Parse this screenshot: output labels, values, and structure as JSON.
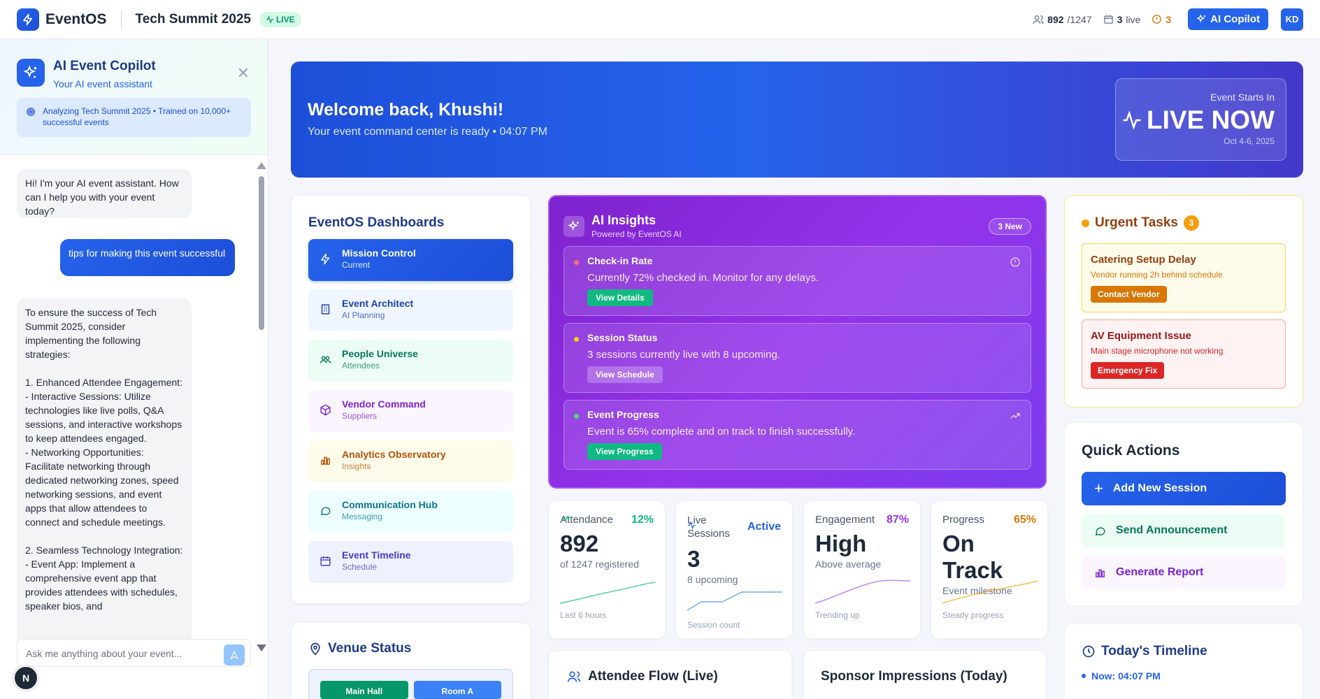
{
  "topbar": {
    "brand": "EventOS",
    "event_title": "Tech Summit 2025",
    "live_label": "LIVE",
    "attendees": "892",
    "attendees_total": "/1247",
    "live_sessions": "3",
    "live_sessions_label": "live",
    "alerts": "3",
    "copilot_label": "AI Copilot",
    "user_initials": "KD"
  },
  "sidebar": {
    "title": "AI Event Copilot",
    "subtitle": "Your AI event assistant",
    "banner": "Analyzing Tech Summit 2025 • Trained on 10,000+ successful events",
    "messages": [
      {
        "role": "bot",
        "text": "Hi! I'm your AI event assistant. How can I help you with your event today?"
      },
      {
        "role": "user",
        "text": "tips for making this event successful"
      },
      {
        "role": "bot",
        "text": "To ensure the success of Tech Summit 2025, consider implementing the following strategies:\n\n1. Enhanced Attendee Engagement:\n- Interactive Sessions: Utilize technologies like live polls, Q&A sessions, and interactive workshops to keep attendees engaged.\n- Networking Opportunities: Facilitate networking through dedicated networking zones, speed networking sessions, and event apps that allow attendees to connect and schedule meetings.\n\n2. Seamless Technology Integration:\n- Event App: Implement a comprehensive event app that provides attendees with schedules, speaker bios, and"
      }
    ],
    "input_placeholder": "Ask me anything about your event...",
    "badge": "N"
  },
  "hero": {
    "greeting": "Welcome back, Khushi!",
    "subtitle": "Your event command center is ready • 04:07 PM",
    "starts_label": "Event Starts In",
    "status": "LIVE NOW",
    "dates": "Oct 4-6, 2025"
  },
  "dashboards": {
    "title": "EventOS Dashboards",
    "items": [
      {
        "label": "Mission Control",
        "sub": "Current"
      },
      {
        "label": "Event Architect",
        "sub": "AI Planning"
      },
      {
        "label": "People Universe",
        "sub": "Attendees"
      },
      {
        "label": "Vendor Command",
        "sub": "Suppliers"
      },
      {
        "label": "Analytics Observatory",
        "sub": "Insights"
      },
      {
        "label": "Communication Hub",
        "sub": "Messaging"
      },
      {
        "label": "Event Timeline",
        "sub": "Schedule"
      }
    ],
    "colors": [
      "#2563eb",
      "#1e40af",
      "#047857",
      "#7e22ce",
      "#b45309",
      "#0e7490",
      "#4338ca"
    ],
    "bg": [
      "#2563eb",
      "#eff6ff",
      "#ecfdf5",
      "#faf5ff",
      "#fffbeb",
      "#ecfeff",
      "#eef2ff"
    ]
  },
  "venue": {
    "title": "Venue Status",
    "rooms": [
      "Main Hall",
      "Room A"
    ]
  },
  "insights": {
    "title": "AI Insights",
    "powered": "Powered by EventOS AI",
    "badge": "3 New",
    "items": [
      {
        "title": "Check-in Rate",
        "desc": "Currently 72% checked in. Monitor for any delays.",
        "button": "View Details"
      },
      {
        "title": "Session Status",
        "desc": "3 sessions currently live with 8 upcoming.",
        "button": "View Schedule"
      },
      {
        "title": "Event Progress",
        "desc": "Event is 65% complete and on track to finish successfully.",
        "button": "View Progress"
      }
    ]
  },
  "kpis": [
    {
      "title": "Attendance",
      "change": "12%",
      "value": "892",
      "sub": "of 1247 registered",
      "foot": "Last 6 hours",
      "color": "#10b981"
    },
    {
      "title": "Live Sessions",
      "change": "Active",
      "value": "3",
      "sub": "8 upcoming",
      "foot": "Session count",
      "color": "#2563eb"
    },
    {
      "title": "Engagement",
      "change": "87%",
      "value": "High",
      "sub": "Above average",
      "foot": "Trending up",
      "color": "#9333ea"
    },
    {
      "title": "Progress",
      "change": "65%",
      "value": "On Track",
      "sub": "Event milestone",
      "foot": "Steady progress",
      "color": "#d97706"
    }
  ],
  "flow": {
    "title": "Attendee Flow (Live)"
  },
  "sponsor": {
    "title": "Sponsor Impressions (Today)"
  },
  "urgent": {
    "title": "Urgent Tasks",
    "count": "3",
    "tasks": [
      {
        "title": "Catering Setup Delay",
        "desc": "Vendor running 2h behind schedule",
        "button": "Contact Vendor"
      },
      {
        "title": "AV Equipment Issue",
        "desc": "Main stage microphone not working",
        "button": "Emergency Fix"
      }
    ]
  },
  "quick": {
    "title": "Quick Actions",
    "actions": [
      "Add New Session",
      "Send Announcement",
      "Generate Report"
    ]
  },
  "timeline": {
    "title": "Today's Timeline",
    "now": "Now: 04:07 PM"
  }
}
